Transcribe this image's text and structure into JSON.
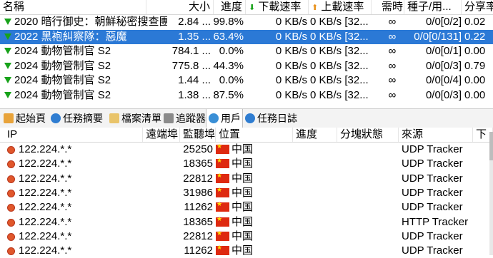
{
  "torrent_table": {
    "columns": {
      "name": "名稱",
      "size": "大小",
      "progress": "進度",
      "down": "下載速率",
      "up": "上載速率",
      "eta": "需時",
      "seeds": "種子/用...",
      "ratio": "分享率"
    },
    "rows": [
      {
        "name": "2020 暗行御史：朝鮮秘密搜查團",
        "size": "2.84 ...",
        "progress": "99.8%",
        "down": "0 KB/s",
        "up": "0 KB/s [32...",
        "eta": "∞",
        "seeds": "0/0[0/2]",
        "ratio": "0.02",
        "selected": false
      },
      {
        "name": "2022 黑袍糾察隊：惡魔",
        "size": "1.35 ...",
        "progress": "63.4%",
        "down": "0 KB/s",
        "up": "0 KB/s [32...",
        "eta": "∞",
        "seeds": "0/0[0/131]",
        "ratio": "0.22",
        "selected": true
      },
      {
        "name": "2024 動物管制官 S2",
        "size": "784.1 ...",
        "progress": "0.0%",
        "down": "0 KB/s",
        "up": "0 KB/s [32...",
        "eta": "∞",
        "seeds": "0/0[0/1]",
        "ratio": "0.00",
        "selected": false
      },
      {
        "name": "2024 動物管制官 S2",
        "size": "775.8 ...",
        "progress": "44.3%",
        "down": "0 KB/s",
        "up": "0 KB/s [32...",
        "eta": "∞",
        "seeds": "0/0[0/3]",
        "ratio": "0.79",
        "selected": false
      },
      {
        "name": "2024 動物管制官 S2",
        "size": "1.44 ...",
        "progress": "0.0%",
        "down": "0 KB/s",
        "up": "0 KB/s [32...",
        "eta": "∞",
        "seeds": "0/0[0/4]",
        "ratio": "0.00",
        "selected": false
      },
      {
        "name": "2024 動物管制官 S2",
        "size": "1.38 ...",
        "progress": "87.5%",
        "down": "0 KB/s",
        "up": "0 KB/s [32...",
        "eta": "∞",
        "seeds": "0/0[0/3]",
        "ratio": "0.00",
        "selected": false
      }
    ]
  },
  "tabs": [
    {
      "label": "起始頁",
      "icon": "home-icon",
      "color": "#e8a33a"
    },
    {
      "label": "任務摘要",
      "icon": "info-icon",
      "color": "#2f7dd1"
    },
    {
      "label": "檔案清單",
      "icon": "files-icon",
      "color": "#e9c46a"
    },
    {
      "label": "追蹤器",
      "icon": "tracker-icon",
      "color": "#8a8a8a"
    },
    {
      "label": "用戶",
      "icon": "users-icon",
      "color": "#3a8fd6",
      "active": true
    },
    {
      "label": "任務日誌",
      "icon": "log-icon",
      "color": "#2f7dd1"
    }
  ],
  "peer_table": {
    "columns": {
      "ip": "IP",
      "remote_port": "遠端埠",
      "listen_port": "監聽埠",
      "location": "位置",
      "progress": "進度",
      "blocks": "分塊狀態",
      "source": "來源",
      "down": "下"
    },
    "rows": [
      {
        "ip": "122.224.*.*",
        "listen_port": "25250",
        "location": "中国",
        "source": "UDP Tracker"
      },
      {
        "ip": "122.224.*.*",
        "listen_port": "18365",
        "location": "中国",
        "source": "UDP Tracker"
      },
      {
        "ip": "122.224.*.*",
        "listen_port": "22812",
        "location": "中国",
        "source": "UDP Tracker"
      },
      {
        "ip": "122.224.*.*",
        "listen_port": "31986",
        "location": "中国",
        "source": "UDP Tracker"
      },
      {
        "ip": "122.224.*.*",
        "listen_port": "11262",
        "location": "中国",
        "source": "UDP Tracker"
      },
      {
        "ip": "122.224.*.*",
        "listen_port": "18365",
        "location": "中国",
        "source": "HTTP Tracker"
      },
      {
        "ip": "122.224.*.*",
        "listen_port": "22812",
        "location": "中国",
        "source": "UDP Tracker"
      },
      {
        "ip": "122.224.*.*",
        "listen_port": "11262",
        "location": "中国",
        "source": "UDP Tracker"
      }
    ]
  },
  "colors": {
    "selection": "#2b79d6",
    "download_arrow": "#18a21a",
    "upload_arrow": "#e8901a"
  }
}
